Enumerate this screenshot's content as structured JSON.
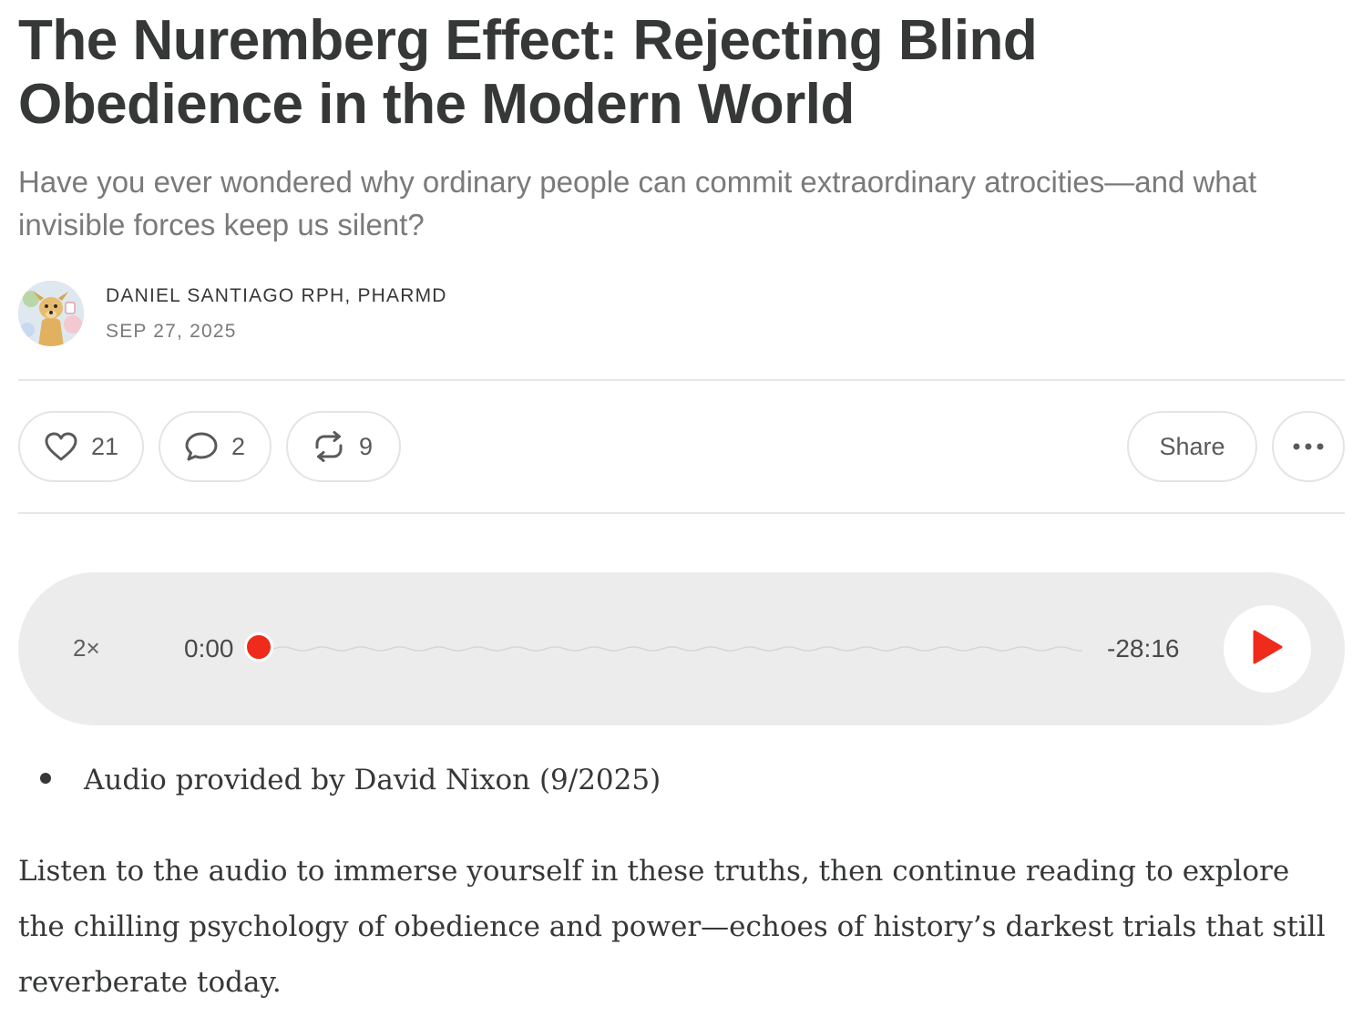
{
  "post": {
    "title": "The Nuremberg Effect: Rejecting Blind Obedience in the Modern World",
    "subtitle": "Have you ever wondered why ordinary people can commit extraordinary atrocities—and what invisible forces keep us silent?",
    "author": "DANIEL SANTIAGO RPH, PHARMD",
    "date": "SEP 27, 2025",
    "avatar_icon": "dog-avatar-icon"
  },
  "actions": {
    "likes": "21",
    "comments": "2",
    "restacks": "9",
    "share_label": "Share",
    "more_icon": "ellipsis-icon"
  },
  "player": {
    "speed": "2×",
    "current_time": "0:00",
    "remaining_time": "-28:16",
    "progress": 0,
    "accent_color": "#ef2b1b"
  },
  "content": {
    "audio_credit": "Audio provided by David Nixon (9/2025)",
    "intro": "Listen to the audio to immerse yourself in these truths, then continue reading to explore the chilling psychology of obedience and power—echoes of history’s darkest trials that still reverberate today."
  }
}
